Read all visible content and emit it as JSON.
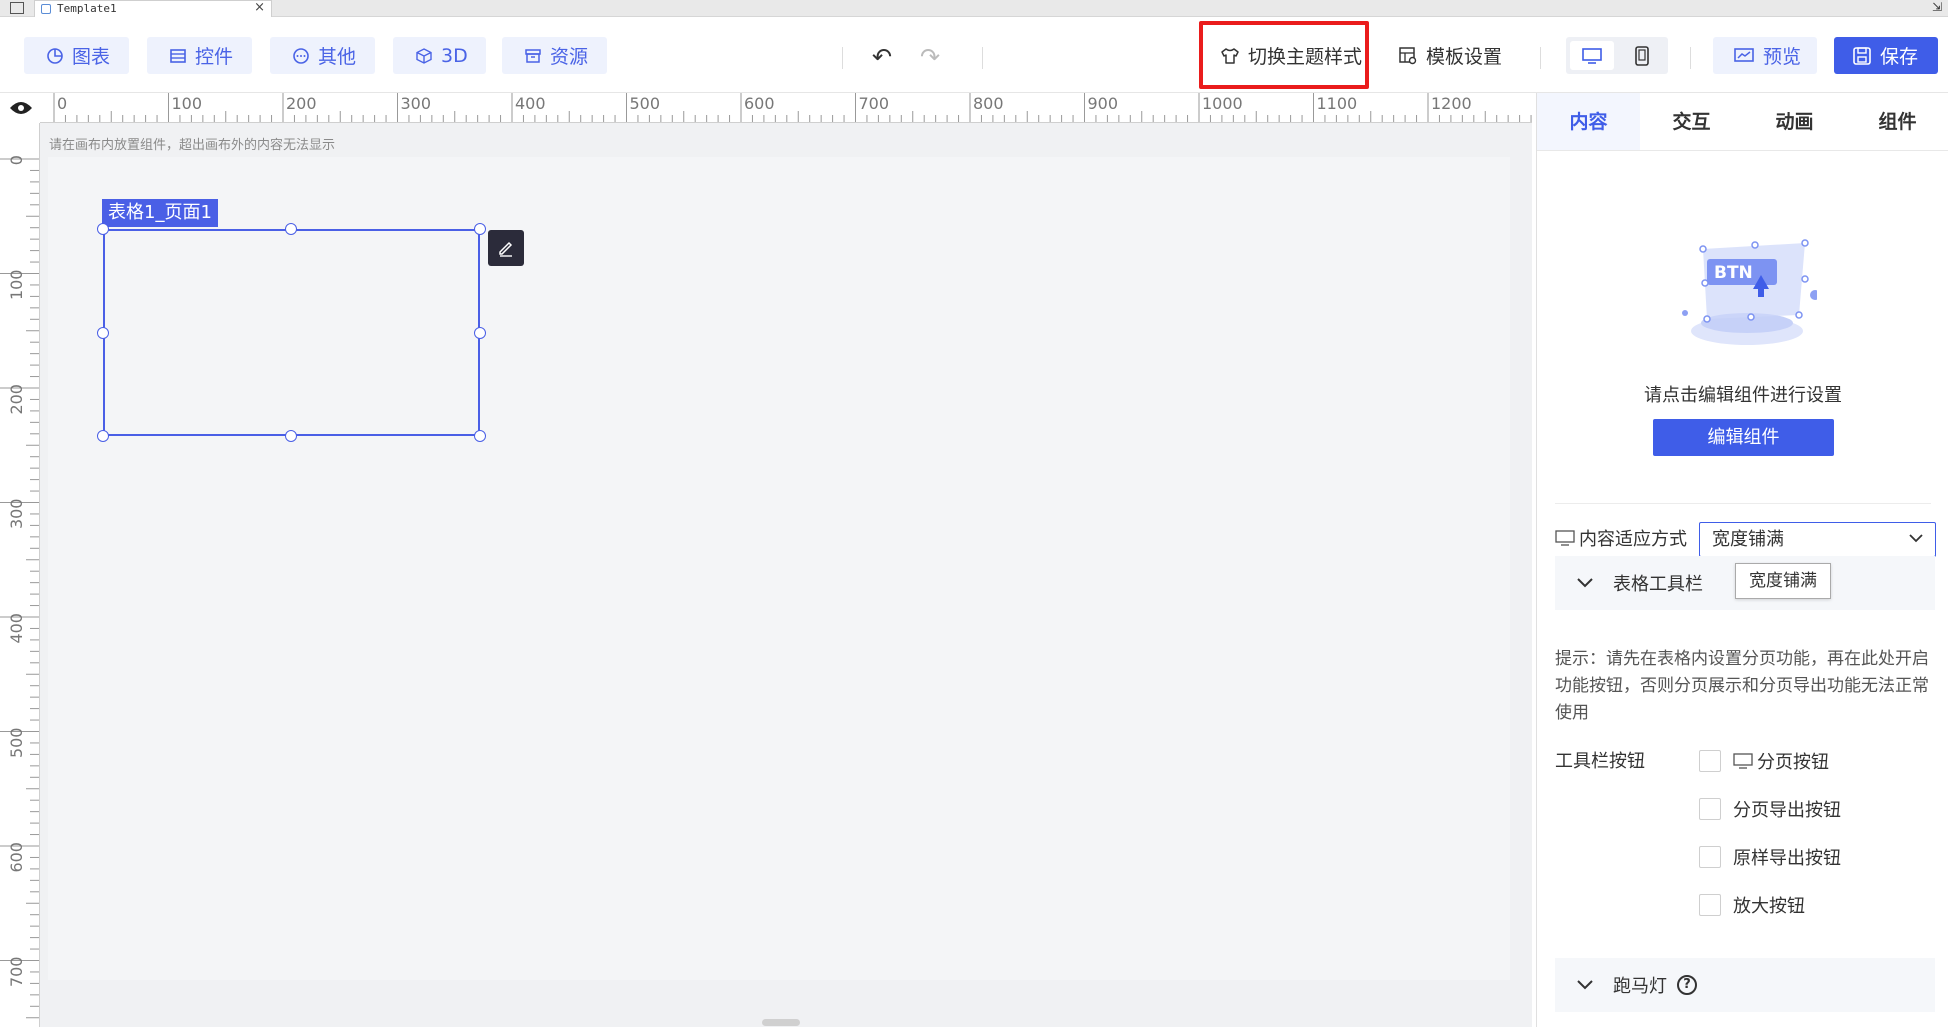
{
  "window": {
    "tab_title": "Template1",
    "tab_close": "×",
    "corner_glyph": "⇲"
  },
  "toolbar": {
    "insert_buttons": [
      {
        "label": "图表",
        "icon": "chart-pie-icon"
      },
      {
        "label": "控件",
        "icon": "widget-icon"
      },
      {
        "label": "其他",
        "icon": "more-circle-icon"
      },
      {
        "label": "3D",
        "icon": "cube-icon"
      },
      {
        "label": "资源",
        "icon": "archive-icon"
      }
    ],
    "undo_glyph": "↶",
    "redo_glyph": "↷",
    "switch_theme_label": "切换主题样式",
    "template_settings_label": "模板设置",
    "preview_label": "预览",
    "save_label": "保存",
    "accent_color": "#3f5de8",
    "highlight_color": "#ea1c1c"
  },
  "rulers": {
    "horizontal_ticks": [
      "0",
      "100",
      "200",
      "300",
      "400",
      "500",
      "600",
      "700",
      "800",
      "900",
      "1000",
      "1100",
      "1200"
    ],
    "vertical_ticks": [
      "0",
      "100",
      "200",
      "300",
      "400",
      "500",
      "600",
      "700"
    ]
  },
  "canvas": {
    "hint": "请在画布内放置组件，超出画布外的内容无法显示",
    "component_label": "表格1_页面1"
  },
  "panel": {
    "tabs": [
      {
        "label": "内容",
        "active": true
      },
      {
        "label": "交互",
        "active": false
      },
      {
        "label": "动画",
        "active": false
      },
      {
        "label": "组件",
        "active": false
      }
    ],
    "illustration_text": "BTN",
    "hint": "请点击编辑组件进行设置",
    "edit_button": "编辑组件",
    "fit_label": "内容适应方式",
    "fit_value": "宽度铺满",
    "fit_tooltip": "宽度铺满",
    "table_toolbar_section": "表格工具栏",
    "tip": "提示：请先在表格内设置分页功能，再在此处开启功能按钮，否则分页展示和分页导出功能无法正常使用",
    "toolbar_buttons_label": "工具栏按钮",
    "checkboxes": [
      {
        "label": "分页按钮",
        "checked": false,
        "has_monitor_icon": true
      },
      {
        "label": "分页导出按钮",
        "checked": false,
        "has_monitor_icon": false
      },
      {
        "label": "原样导出按钮",
        "checked": false,
        "has_monitor_icon": false
      },
      {
        "label": "放大按钮",
        "checked": false,
        "has_monitor_icon": false
      }
    ],
    "marquee_section": "跑马灯",
    "help_glyph": "?"
  }
}
